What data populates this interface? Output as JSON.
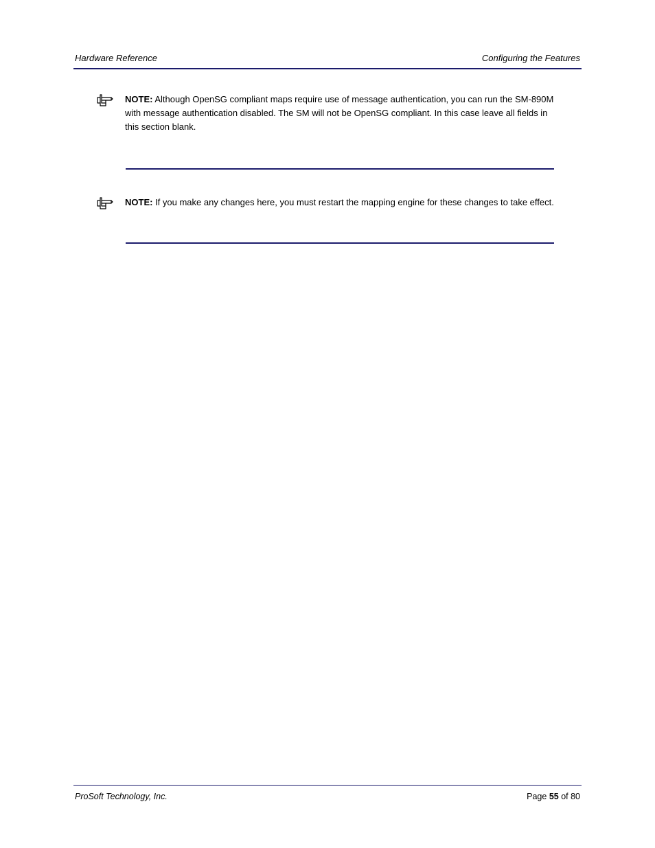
{
  "header": {
    "left": "Hardware Reference",
    "right": "Configuring the Features"
  },
  "note1": {
    "label": "NOTE:",
    "text": " Although OpenSG compliant maps require use of message authentication, you can run the SM-890M with message authentication disabled. The SM will not be OpenSG compliant. In this case leave all fields in this section blank."
  },
  "note2": {
    "label": "NOTE:",
    "text": " If you make any changes here, you must restart the mapping engine for these changes to take effect."
  },
  "footer": {
    "left": "ProSoft Technology, Inc.",
    "right_text": "Page ",
    "right_page": "55",
    "right_tail": " of 80"
  }
}
